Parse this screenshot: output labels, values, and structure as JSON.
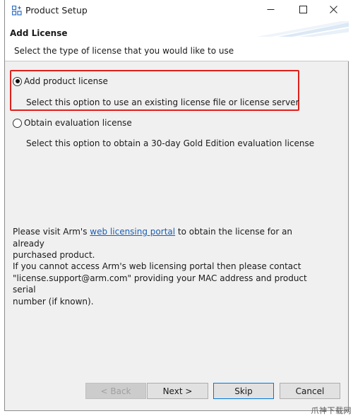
{
  "window": {
    "title": "Product Setup",
    "icon": "product-setup-icon",
    "controls": {
      "minimize": "minimize-icon",
      "maximize": "maximize-icon",
      "close": "close-icon"
    }
  },
  "header": {
    "title": "Add License",
    "subtitle": "Select the type of license that you would like to use"
  },
  "options": [
    {
      "label": "Add product license",
      "description": "Select this option to use an existing license file or license server",
      "selected": true
    },
    {
      "label": "Obtain evaluation license",
      "description": "Select this option to obtain a 30-day Gold Edition evaluation license",
      "selected": false
    }
  ],
  "info": {
    "visit_prefix": "Please visit Arm's",
    "link_text": "web licensing portal",
    "visit_suffix_1": "to obtain the license for an already",
    "visit_suffix_2": "purchased product.",
    "contact_line_1": "If you cannot access Arm's web licensing portal then please contact",
    "contact_line_2": "\"license.support@arm.com\" providing your MAC address and product serial",
    "contact_line_3": "number (if known)."
  },
  "buttons": {
    "back": "< Back",
    "next": "Next >",
    "skip": "Skip",
    "cancel": "Cancel"
  },
  "colors": {
    "highlight": "#e0201b",
    "link": "#1a5fb4",
    "focus_border": "#0078d7"
  },
  "watermark": "爪神下载网"
}
